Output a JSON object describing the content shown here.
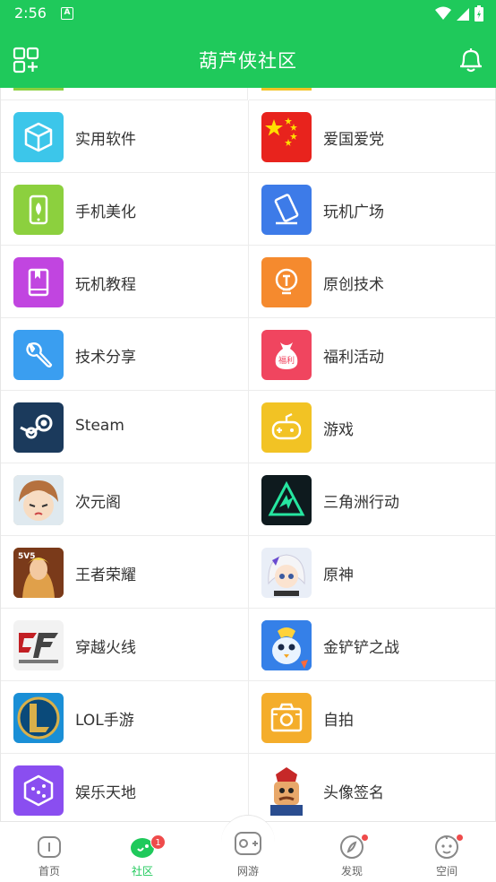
{
  "status_bar": {
    "time": "2:56",
    "notif_letter": "A"
  },
  "header": {
    "title": "葫芦侠社区",
    "left_icon": "grid-add-icon",
    "right_icon": "bell-icon"
  },
  "grid": {
    "rows": [
      {
        "left": {
          "label": "实用软件",
          "icon": "cube-icon",
          "color": "#3cc6ea"
        },
        "right": {
          "label": "爱国爱党",
          "icon": "china-flag-icon",
          "color": "#e8231d"
        }
      },
      {
        "left": {
          "label": "手机美化",
          "icon": "phone-leaf-icon",
          "color": "#8cd03e"
        },
        "right": {
          "label": "玩机广场",
          "icon": "phone-tilt-icon",
          "color": "#3d7be8"
        }
      },
      {
        "left": {
          "label": "玩机教程",
          "icon": "book-icon",
          "color": "#c145e0"
        },
        "right": {
          "label": "原创技术",
          "icon": "bulb-icon",
          "color": "#f58a2e"
        }
      },
      {
        "left": {
          "label": "技术分享",
          "icon": "wrench-icon",
          "color": "#3a9ef0"
        },
        "right": {
          "label": "福利活动",
          "icon": "gift-bag-icon",
          "color": "#f0455f"
        }
      },
      {
        "left": {
          "label": "Steam",
          "icon": "steam-icon",
          "color": "#1b3a5c"
        },
        "right": {
          "label": "游戏",
          "icon": "gamepad-icon",
          "color": "#f2c324"
        }
      },
      {
        "left": {
          "label": "次元阁",
          "icon": "anime-avatar-icon",
          "color": "#e0c9a8"
        },
        "right": {
          "label": "三角洲行动",
          "icon": "delta-force-icon",
          "color": "#0e1a1e"
        }
      },
      {
        "left": {
          "label": "王者荣耀",
          "icon": "honor-of-kings-icon",
          "color": "#c8892e"
        },
        "right": {
          "label": "原神",
          "icon": "genshin-icon",
          "color": "#e9eef7"
        }
      },
      {
        "left": {
          "label": "穿越火线",
          "icon": "crossfire-icon",
          "color": "#f2f2f2"
        },
        "right": {
          "label": "金铲铲之战",
          "icon": "golden-spatula-icon",
          "color": "#2b6fd8"
        }
      },
      {
        "left": {
          "label": "LOL手游",
          "icon": "lol-icon",
          "color": "#1a8fd6"
        },
        "right": {
          "label": "自拍",
          "icon": "camera-icon",
          "color": "#f4ad2b"
        }
      },
      {
        "left": {
          "label": "娱乐天地",
          "icon": "dice-icon",
          "color": "#8a4ef0"
        },
        "right": {
          "label": "头像签名",
          "icon": "avatar-character-icon",
          "color": "#ffffff"
        }
      }
    ]
  },
  "bottom_nav": {
    "items": [
      {
        "label": "首页",
        "icon": "home-icon"
      },
      {
        "label": "社区",
        "icon": "community-icon",
        "badge": "1"
      },
      {
        "label": "网游",
        "icon": "online-game-icon"
      },
      {
        "label": "发现",
        "icon": "compass-icon"
      },
      {
        "label": "空间",
        "icon": "face-icon"
      }
    ],
    "active_color": "#1fc95b"
  }
}
